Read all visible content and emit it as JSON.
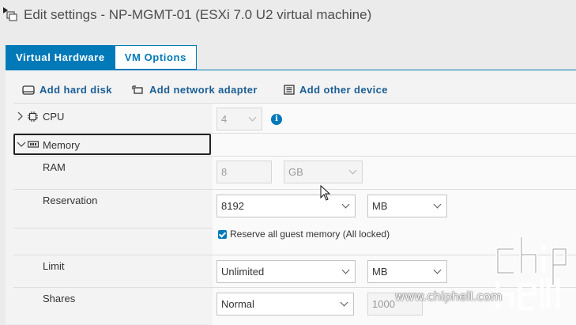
{
  "window": {
    "title": "Edit settings - NP-MGMT-01 (ESXi 7.0 U2 virtual machine)"
  },
  "tabs": [
    {
      "label": "Virtual Hardware",
      "active": true
    },
    {
      "label": "VM Options",
      "active": false
    }
  ],
  "toolbar": {
    "add_hard_disk": "Add hard disk",
    "add_network_adapter": "Add network adapter",
    "add_other_device": "Add other device"
  },
  "cpu": {
    "label": "CPU",
    "value": "4"
  },
  "memory": {
    "label": "Memory",
    "ram": {
      "label": "RAM",
      "value": "8",
      "unit": "GB"
    },
    "reservation": {
      "label": "Reservation",
      "value": "8192",
      "unit": "MB",
      "reserve_all_label": "Reserve all guest memory (All locked)",
      "reserve_all_checked": true
    },
    "limit": {
      "label": "Limit",
      "value": "Unlimited",
      "unit": "MB"
    },
    "shares": {
      "label": "Shares",
      "value": "Normal",
      "number": "1000"
    }
  },
  "watermark": {
    "text": "www.chiphell.com"
  },
  "colors": {
    "accent": "#0079b8",
    "link": "#1b5e94",
    "background": "#ebebeb"
  }
}
